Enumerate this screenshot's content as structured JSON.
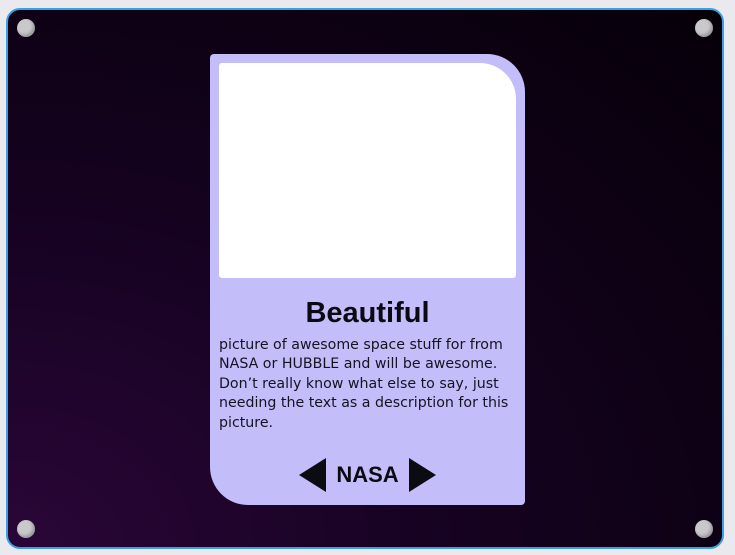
{
  "card": {
    "title": "Beautiful",
    "description": "picture of awesome space stuff for from NASA or HUBBLE and will be awesome. Don’t really know what else to say, just needing the text as a description for this picture.",
    "source_label": "NASA"
  },
  "colors": {
    "frame_border": "#3aa0e0",
    "card_background": "#c3bdfa",
    "image_placeholder": "#ffffff",
    "screw": "#c9c9cc"
  },
  "icons": {
    "prev": "triangle-left-icon",
    "next": "triangle-right-icon"
  }
}
